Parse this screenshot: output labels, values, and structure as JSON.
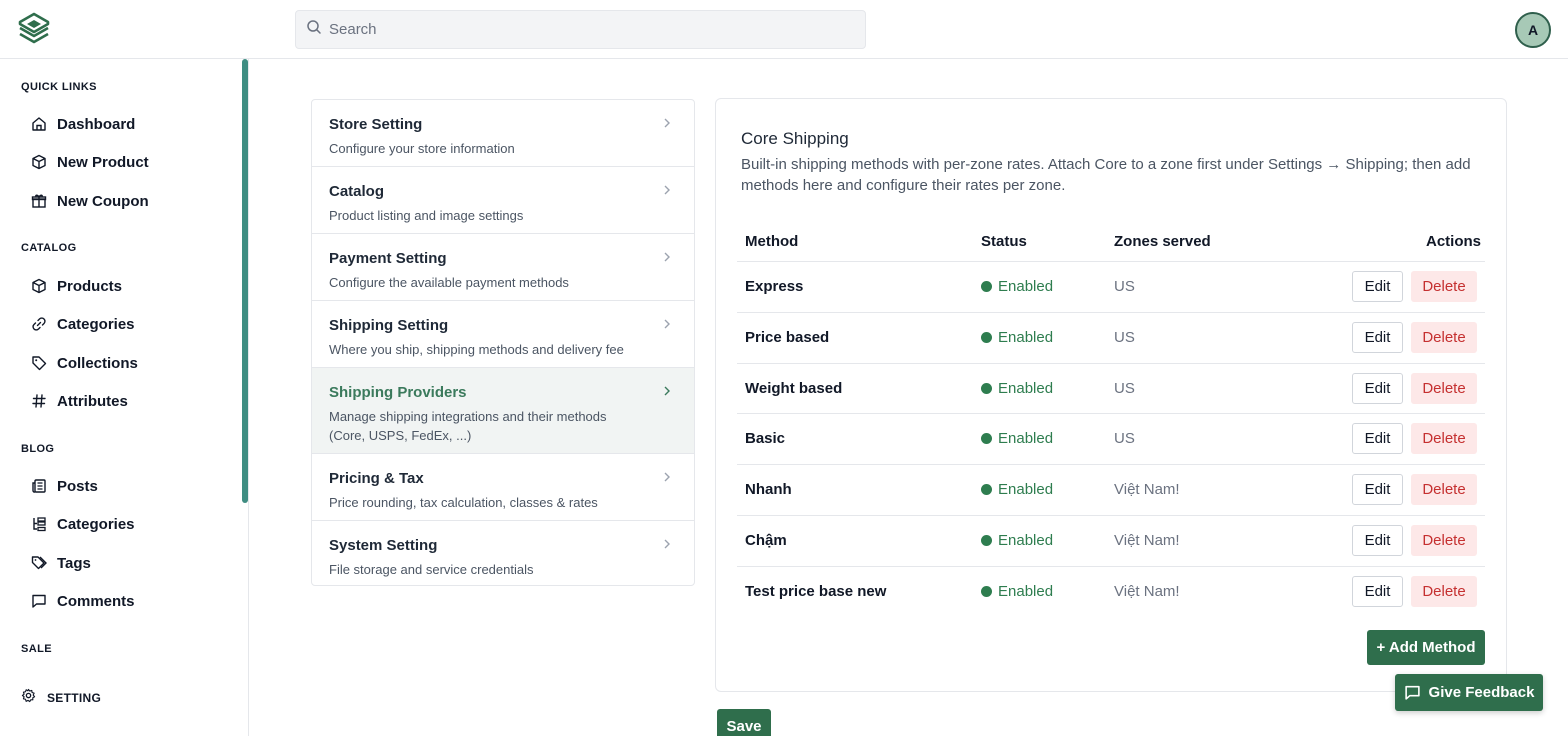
{
  "header": {
    "search_placeholder": "Search",
    "avatar_initial": "A"
  },
  "sidebar": {
    "sections": {
      "quick_links": "QUICK LINKS",
      "catalog": "CATALOG",
      "blog": "BLOG",
      "sale": "SALE"
    },
    "quick_links": [
      {
        "label": "Dashboard",
        "icon": "home-icon"
      },
      {
        "label": "New Product",
        "icon": "box-icon"
      },
      {
        "label": "New Coupon",
        "icon": "gift-icon"
      }
    ],
    "catalog": [
      {
        "label": "Products",
        "icon": "box-icon"
      },
      {
        "label": "Categories",
        "icon": "link-icon"
      },
      {
        "label": "Collections",
        "icon": "tag-icon"
      },
      {
        "label": "Attributes",
        "icon": "hash-icon"
      }
    ],
    "blog": [
      {
        "label": "Posts",
        "icon": "newspaper-icon"
      },
      {
        "label": "Categories",
        "icon": "tree-icon"
      },
      {
        "label": "Tags",
        "icon": "tags-icon"
      },
      {
        "label": "Comments",
        "icon": "comment-icon"
      }
    ],
    "setting_label": "SETTING"
  },
  "settings_menu": [
    {
      "title": "Store Setting",
      "desc": "Configure your store information"
    },
    {
      "title": "Catalog",
      "desc": "Product listing and image settings"
    },
    {
      "title": "Payment Setting",
      "desc": "Configure the available payment methods"
    },
    {
      "title": "Shipping Setting",
      "desc": "Where you ship, shipping methods and delivery fee"
    },
    {
      "title": "Shipping Providers",
      "desc": "Manage shipping integrations and their methods (Core, USPS, FedEx, ...)",
      "active": true
    },
    {
      "title": "Pricing & Tax",
      "desc": "Price rounding, tax calculation, classes & rates"
    },
    {
      "title": "System Setting",
      "desc": "File storage and service credentials"
    }
  ],
  "card": {
    "title": "Core Shipping",
    "description": "Built-in shipping methods with per-zone rates. Attach Core to a zone first under Settings → Shipping; then add methods here and configure their rates per zone.",
    "columns": {
      "method": "Method",
      "status": "Status",
      "zones": "Zones served",
      "actions": "Actions"
    },
    "rows": [
      {
        "method": "Express",
        "status": "Enabled",
        "zones": "US"
      },
      {
        "method": "Price based",
        "status": "Enabled",
        "zones": "US"
      },
      {
        "method": "Weight based",
        "status": "Enabled",
        "zones": "US"
      },
      {
        "method": "Basic",
        "status": "Enabled",
        "zones": "US"
      },
      {
        "method": "Nhanh",
        "status": "Enabled",
        "zones": "Việt Nam!"
      },
      {
        "method": "Chậm",
        "status": "Enabled",
        "zones": "Việt Nam!"
      },
      {
        "method": "Test price base new",
        "status": "Enabled",
        "zones": "Việt Nam!"
      }
    ],
    "edit_label": "Edit",
    "delete_label": "Delete",
    "add_label": "+ Add Method"
  },
  "save_label": "Save",
  "feedback_label": "Give Feedback",
  "colors": {
    "brand": "#2f6e4c",
    "enabled": "#2e7d4f",
    "delete_text": "#c53030",
    "delete_bg": "#fde8e8",
    "active_menu_text": "#3b7a5c"
  }
}
